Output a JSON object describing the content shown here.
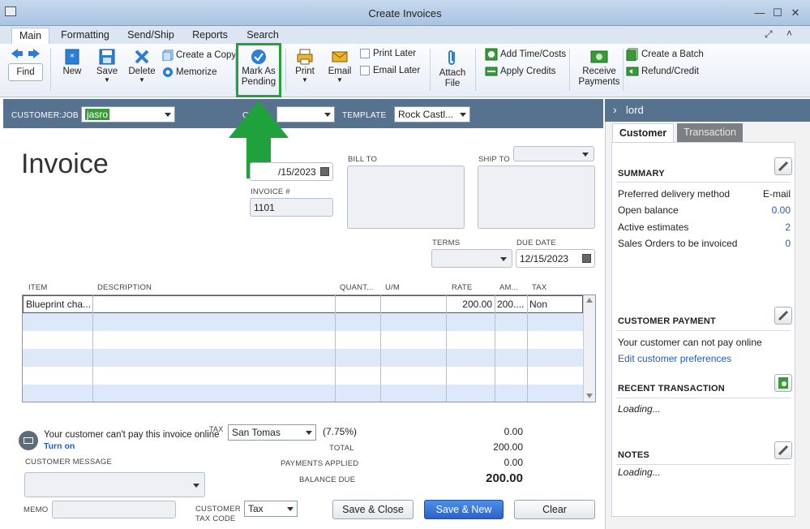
{
  "window": {
    "title": "Create Invoices"
  },
  "tabs": [
    "Main",
    "Formatting",
    "Send/Ship",
    "Reports",
    "Search"
  ],
  "toolbar": {
    "find": "Find",
    "new": "New",
    "save": "Save",
    "delete": "Delete",
    "create_copy": "Create a Copy",
    "memorize": "Memorize",
    "mark_as": "Mark As",
    "pending": "Pending",
    "print": "Print",
    "email": "Email",
    "print_later": "Print Later",
    "email_later": "Email Later",
    "attach": "Attach",
    "file": "File",
    "add_time_costs": "Add Time/Costs",
    "apply_credits": "Apply Credits",
    "receive": "Receive",
    "payments": "Payments",
    "create_batch": "Create a Batch",
    "refund_credit": "Refund/Credit"
  },
  "header": {
    "customer_job_label": "CUSTOMER:JOB",
    "customer_job_value": "jasro",
    "class_label": "CL",
    "template_label": "TEMPLATE",
    "template_value": "Rock Castl..."
  },
  "invoice": {
    "title": "Invoice",
    "date_value": "/15/2023",
    "invoice_no_label": "INVOICE #",
    "invoice_no_value": "1101",
    "bill_to_label": "BILL TO",
    "ship_to_label": "SHIP TO",
    "terms_label": "TERMS",
    "due_date_label": "DUE DATE",
    "due_date_value": "12/15/2023"
  },
  "table": {
    "headers": [
      "ITEM",
      "DESCRIPTION",
      "QUANT...",
      "U/M",
      "RATE",
      "AM...",
      "TAX"
    ],
    "rows": [
      {
        "item": "Blueprint cha...",
        "description": "",
        "quantity": "",
        "um": "",
        "rate": "200.00",
        "amount": "200....",
        "tax": "Non"
      }
    ]
  },
  "footer": {
    "online_pay_msg": "Your customer can't pay this invoice online",
    "turn_on": "Turn on",
    "customer_message_label": "CUSTOMER MESSAGE",
    "memo_label": "MEMO",
    "tax_label": "TAX",
    "tax_value": "San Tomas",
    "tax_rate": "(7.75%)",
    "tax_amount": "0.00",
    "total_label": "TOTAL",
    "total_value": "200.00",
    "payments_applied_label": "PAYMENTS APPLIED",
    "payments_applied_value": "0.00",
    "balance_due_label": "BALANCE DUE",
    "balance_due_value": "200.00",
    "customer_tax_code_label_1": "CUSTOMER",
    "customer_tax_code_label_2": "TAX CODE",
    "customer_tax_code_value": "Tax",
    "save_close": "Save & Close",
    "save_new": "Save & New",
    "clear": "Clear"
  },
  "panel": {
    "name": "lord",
    "tab_customer": "Customer",
    "tab_transaction": "Transaction",
    "summary_label": "SUMMARY",
    "summary": [
      {
        "label": "Preferred delivery method",
        "value": "E-mail"
      },
      {
        "label": "Open balance",
        "value": "0.00"
      },
      {
        "label": "Active estimates",
        "value": "2"
      },
      {
        "label": "Sales Orders to be invoiced",
        "value": "0"
      }
    ],
    "customer_payment_label": "CUSTOMER PAYMENT",
    "customer_payment_msg": "Your customer can not pay online",
    "edit_prefs": "Edit customer preferences",
    "recent_transaction_label": "RECENT TRANSACTION",
    "recent_loading": "Loading...",
    "notes_label": "NOTES",
    "notes_loading": "Loading..."
  },
  "colors": {
    "header_band": "#57728f",
    "highlight": "#22a33a",
    "link": "#1f5fbf",
    "primary_button": "#2a63c7"
  }
}
